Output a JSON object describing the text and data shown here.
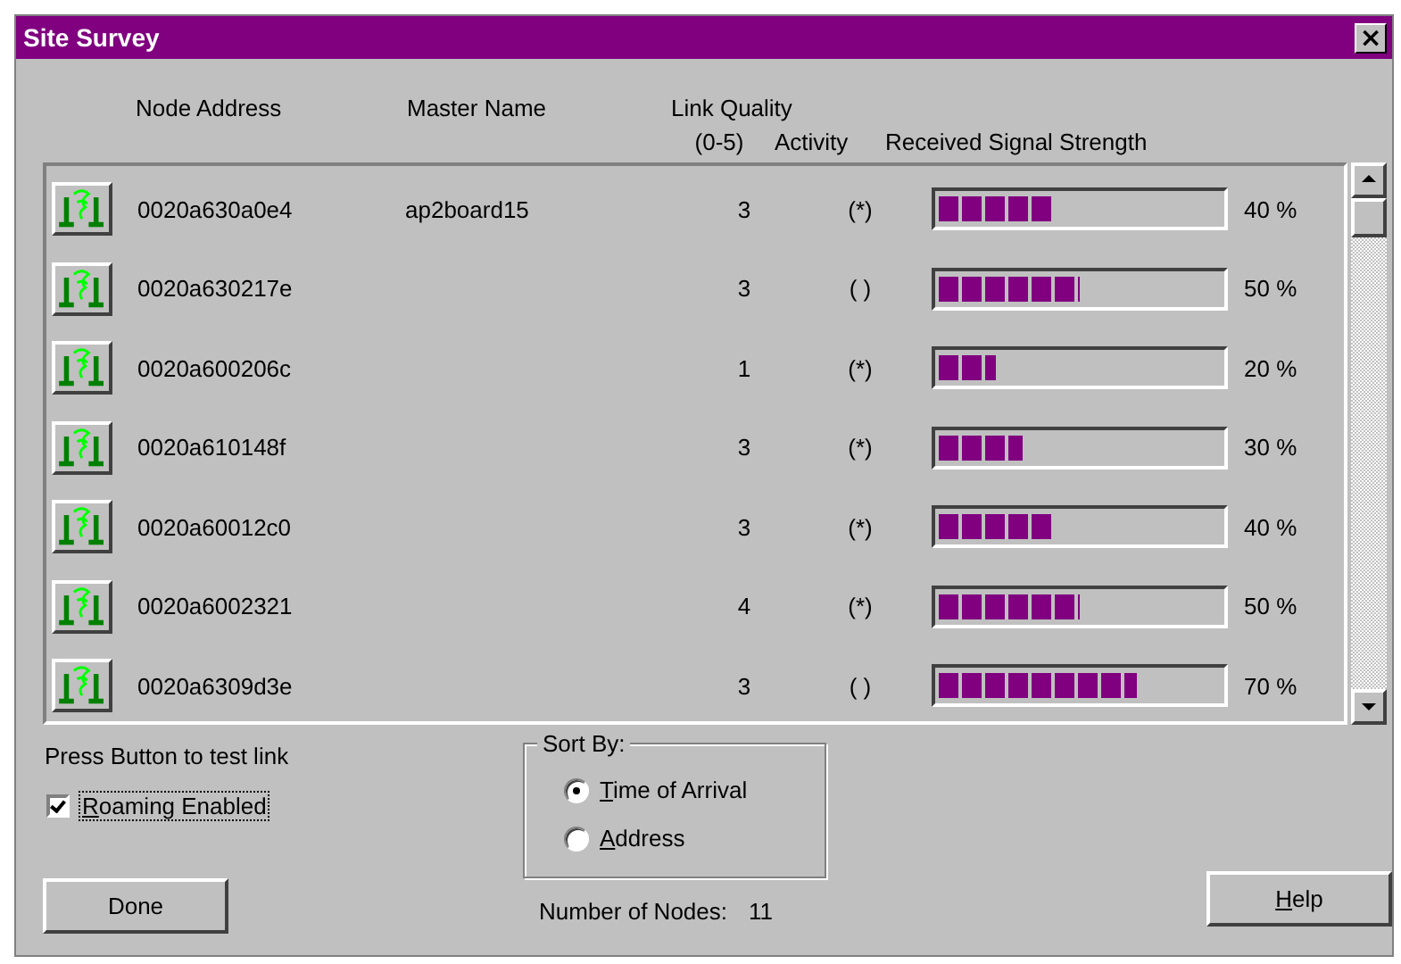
{
  "window": {
    "title": "Site Survey",
    "close": "×"
  },
  "columns": {
    "node_address": "Node Address",
    "master_name": "Master Name",
    "link_quality": "Link Quality",
    "link_quality_range": "(0-5)",
    "activity": "Activity",
    "signal": "Received Signal Strength"
  },
  "rows": [
    {
      "address": "0020a630a0e4",
      "master": "ap2board15",
      "quality": "3",
      "activity": "(*)",
      "level": 0.4,
      "reading": "40 %"
    },
    {
      "address": "0020a630217e",
      "quality": "3",
      "activity": "( )",
      "level": 0.5,
      "reading": "50 %"
    },
    {
      "address": "0020a600206c",
      "quality": "1",
      "activity": "(*)",
      "level": 0.2,
      "reading": "20 %"
    },
    {
      "address": "0020a610148f",
      "quality": "3",
      "activity": "(*)",
      "level": 0.3,
      "reading": "30 %"
    },
    {
      "address": "0020a60012c0",
      "quality": "3",
      "activity": "(*)",
      "level": 0.4,
      "reading": "40 %"
    },
    {
      "address": "0020a6002321",
      "quality": "4",
      "activity": "(*)",
      "level": 0.5,
      "reading": "50 %"
    },
    {
      "address": "0020a6309d3e",
      "quality": "3",
      "activity": "( )",
      "level": 0.7,
      "reading": "70 %"
    }
  ],
  "hint": "Press Button to test link",
  "roaming": {
    "label": "Roaming Enabled",
    "checked": true
  },
  "sort_by": {
    "title": "Sort By:",
    "options": [
      {
        "label": "Time of Arrival",
        "selected": true
      },
      {
        "label": "Address",
        "selected": false
      }
    ]
  },
  "node_count": {
    "label": "Number of Nodes:",
    "value": "11"
  },
  "buttons": {
    "done": "Done",
    "help": "Help"
  }
}
